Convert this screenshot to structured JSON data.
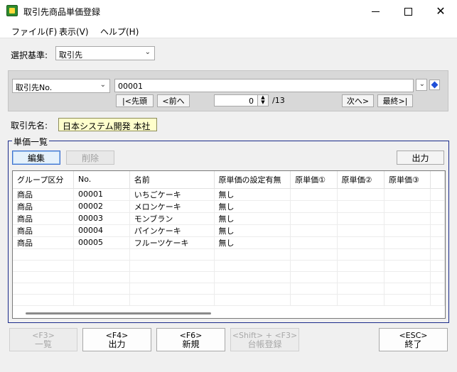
{
  "window": {
    "title": "取引先商品単価登録"
  },
  "window_controls": {
    "minimize": "minimize",
    "maximize": "maximize",
    "close": "✕"
  },
  "menu": {
    "items": [
      "ファイル(F)",
      "表示(V)",
      "ヘルプ(H)"
    ]
  },
  "selection": {
    "label": "選択基準:",
    "value": "取引先"
  },
  "search": {
    "field_select": "取引先No.",
    "code_value": "00001",
    "nav_first": "|<先頭",
    "nav_prev": "<前へ",
    "record_position": "0",
    "record_total": "/13",
    "nav_next": "次へ>",
    "nav_last": "最終>|"
  },
  "partner": {
    "label": "取引先名:",
    "name": "日本システム開発 本社"
  },
  "price_list": {
    "title": "単価一覧",
    "edit_label": "編集",
    "delete_label": "削除",
    "output_label": "出力",
    "columns": [
      "グループ区分",
      "No.",
      "名前",
      "原単価の設定有無",
      "原単価①",
      "原単価②",
      "原単価③"
    ],
    "rows": [
      [
        "商品",
        "00001",
        "いちごケーキ",
        "無し",
        "",
        "",
        ""
      ],
      [
        "商品",
        "00002",
        "メロンケーキ",
        "無し",
        "",
        "",
        ""
      ],
      [
        "商品",
        "00003",
        "モンブラン",
        "無し",
        "",
        "",
        ""
      ],
      [
        "商品",
        "00004",
        "パインケーキ",
        "無し",
        "",
        "",
        ""
      ],
      [
        "商品",
        "00005",
        "フルーツケーキ",
        "無し",
        "",
        "",
        ""
      ]
    ]
  },
  "function_keys": [
    {
      "key": "<F3>",
      "label": "一覧",
      "enabled": false
    },
    {
      "key": "<F4>",
      "label": "出力",
      "enabled": true
    },
    {
      "key": "<F6>",
      "label": "新規",
      "enabled": true
    },
    {
      "key": "<Shift> + <F3>",
      "label": "台帳登録",
      "enabled": false
    },
    {
      "key": "<ESC>",
      "label": "終了",
      "enabled": true
    }
  ],
  "colors": {
    "accent": "#1a2a8a",
    "name_box_bg": "#ffffcc",
    "app_icon": "#2e8b2e"
  },
  "icons": [
    "app-icon",
    "chevron-down-icon",
    "diamond-icon",
    "spin-up-icon",
    "spin-down-icon"
  ]
}
